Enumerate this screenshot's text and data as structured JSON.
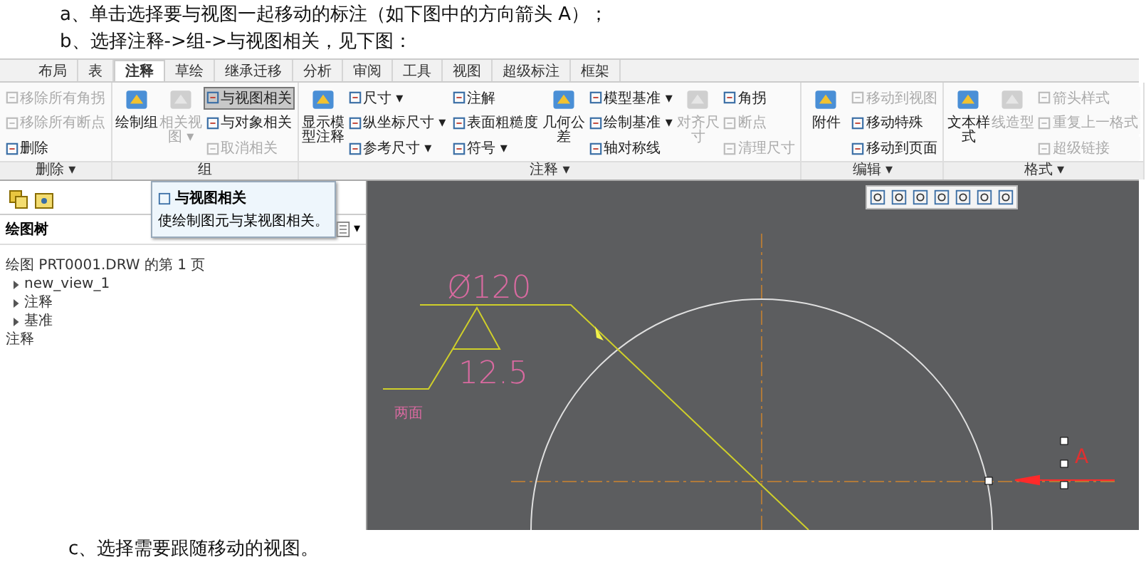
{
  "doc_lines": [
    "a、单击选择要与视图一起移动的标注（如下图中的方向箭头 A）；",
    "b、选择注释->组->与视图相关，见下图："
  ],
  "ribbon": {
    "tabs": [
      {
        "label": "布局",
        "selected": false
      },
      {
        "label": "表",
        "selected": false
      },
      {
        "label": "注释",
        "selected": true
      },
      {
        "label": "草绘",
        "selected": false
      },
      {
        "label": "继承迁移",
        "selected": false
      },
      {
        "label": "分析",
        "selected": false
      },
      {
        "label": "审阅",
        "selected": false
      },
      {
        "label": "工具",
        "selected": false
      },
      {
        "label": "视图",
        "selected": false
      },
      {
        "label": "超级标注",
        "selected": false
      },
      {
        "label": "框架",
        "selected": false
      }
    ],
    "groups": [
      {
        "label": "删除 ▾",
        "columns": [
          {
            "kind": "small",
            "items": [
              {
                "label": "移除所有角拐",
                "disabled": true,
                "highlighted": false
              },
              {
                "label": "移除所有断点",
                "disabled": true,
                "highlighted": false
              },
              {
                "label": "删除",
                "disabled": false,
                "highlighted": false
              }
            ]
          }
        ]
      },
      {
        "label": "组",
        "columns": [
          {
            "kind": "large",
            "items": [
              {
                "label": "绘制组",
                "disabled": false
              }
            ]
          },
          {
            "kind": "large",
            "items": [
              {
                "label": "相关视图 ▾",
                "disabled": true
              }
            ]
          },
          {
            "kind": "small",
            "items": [
              {
                "label": "与视图相关",
                "disabled": false,
                "highlighted": true
              },
              {
                "label": "与对象相关",
                "disabled": false,
                "highlighted": false
              },
              {
                "label": "取消相关",
                "disabled": true,
                "highlighted": false
              }
            ]
          }
        ]
      },
      {
        "label": "注释 ▾",
        "columns": [
          {
            "kind": "large",
            "items": [
              {
                "label": "显示模型注释",
                "disabled": false
              }
            ]
          },
          {
            "kind": "small",
            "items": [
              {
                "label": "尺寸 ▾",
                "disabled": false,
                "highlighted": false
              },
              {
                "label": "纵坐标尺寸 ▾",
                "disabled": false,
                "highlighted": false
              },
              {
                "label": "参考尺寸 ▾",
                "disabled": false,
                "highlighted": false
              }
            ]
          },
          {
            "kind": "small",
            "items": [
              {
                "label": "注解",
                "disabled": false,
                "highlighted": false
              },
              {
                "label": "表面粗糙度",
                "disabled": false,
                "highlighted": false
              },
              {
                "label": "符号 ▾",
                "disabled": false,
                "highlighted": false
              }
            ]
          },
          {
            "kind": "large",
            "items": [
              {
                "label": "几何公差",
                "disabled": false
              }
            ]
          },
          {
            "kind": "small",
            "items": [
              {
                "label": "模型基准 ▾",
                "disabled": false,
                "highlighted": false
              },
              {
                "label": "绘制基准 ▾",
                "disabled": false,
                "highlighted": false
              },
              {
                "label": "轴对称线",
                "disabled": false,
                "highlighted": false
              }
            ]
          },
          {
            "kind": "large",
            "items": [
              {
                "label": "对齐尺寸",
                "disabled": true
              }
            ]
          },
          {
            "kind": "small",
            "items": [
              {
                "label": "角拐",
                "disabled": false,
                "highlighted": false
              },
              {
                "label": "断点",
                "disabled": true,
                "highlighted": false
              },
              {
                "label": "清理尺寸",
                "disabled": true,
                "highlighted": false
              }
            ]
          }
        ]
      },
      {
        "label": "编辑 ▾",
        "columns": [
          {
            "kind": "large",
            "items": [
              {
                "label": "附件",
                "disabled": false
              }
            ]
          },
          {
            "kind": "small",
            "items": [
              {
                "label": "移动到视图",
                "disabled": true,
                "highlighted": false
              },
              {
                "label": "移动特殊",
                "disabled": false,
                "highlighted": false
              },
              {
                "label": "移动到页面",
                "disabled": false,
                "highlighted": false
              }
            ]
          }
        ]
      },
      {
        "label": "格式 ▾",
        "columns": [
          {
            "kind": "large",
            "items": [
              {
                "label": "文本样式",
                "disabled": false
              }
            ]
          },
          {
            "kind": "large",
            "items": [
              {
                "label": "线造型",
                "disabled": true
              }
            ]
          },
          {
            "kind": "small",
            "items": [
              {
                "label": "箭头样式",
                "disabled": true,
                "highlighted": false
              },
              {
                "label": "重复上一格式",
                "disabled": true,
                "highlighted": false
              },
              {
                "label": "超级链接",
                "disabled": true,
                "highlighted": false
              }
            ]
          }
        ]
      }
    ]
  },
  "tooltip": {
    "title": "与视图相关",
    "text": "使绘制图元与某视图相关。"
  },
  "tree_panel": {
    "title": "绘图树",
    "menu_caret": "▾",
    "items": [
      {
        "label": "绘图 PRT0001.DRW 的第 1 页",
        "children": [
          {
            "label": "new_view_1",
            "expanded": false
          },
          {
            "label": "注释",
            "expanded": false
          },
          {
            "label": "基准",
            "expanded": false
          }
        ]
      },
      {
        "label": "注释"
      }
    ]
  },
  "drawing": {
    "diameter": "Ø120",
    "roughness": "12.5",
    "note": "两面",
    "arrow_label": "A"
  },
  "footer_line": "c、选择需要跟随移动的视图。"
}
